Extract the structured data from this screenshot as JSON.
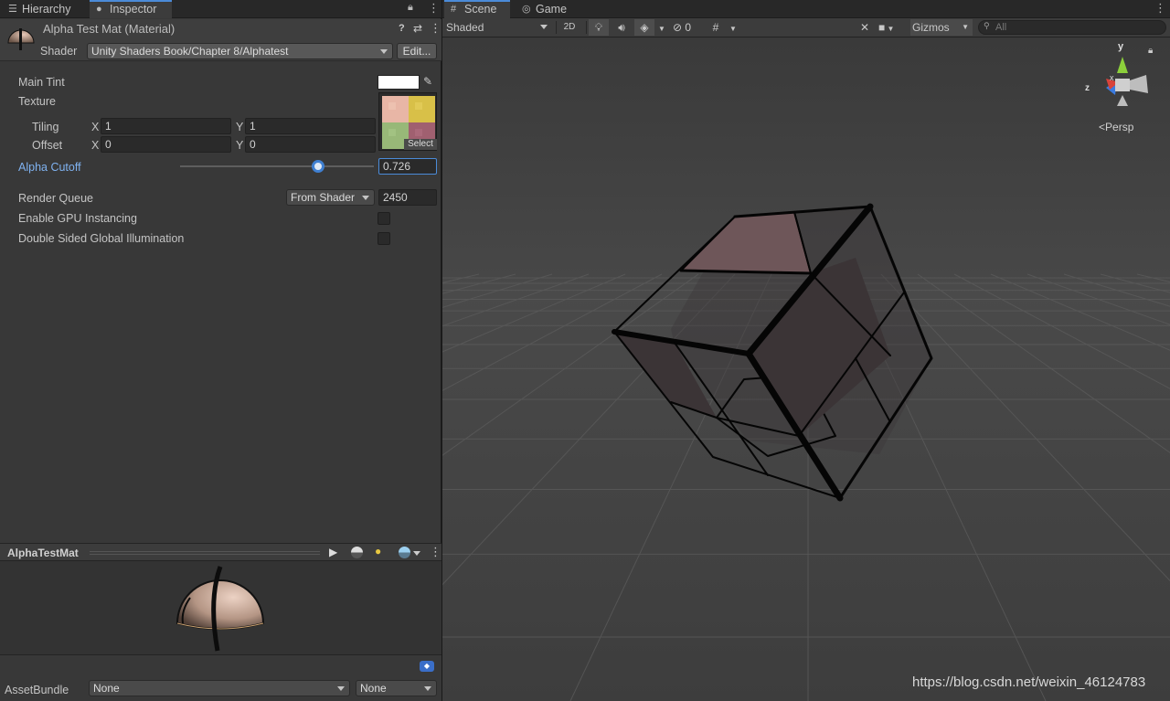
{
  "left_tabs": {
    "hierarchy": "Hierarchy",
    "inspector": "Inspector"
  },
  "material": {
    "title": "Alpha Test Mat (Material)",
    "shader_label": "Shader",
    "shader_value": "Unity Shaders Book/Chapter 8/Alphatest",
    "edit_button": "Edit...",
    "main_tint_label": "Main Tint",
    "main_tint_color": "#ffffff",
    "texture_label": "Texture",
    "texture_select": "Select",
    "tiling_label": "Tiling",
    "tiling_x": "1",
    "tiling_y": "1",
    "offset_label": "Offset",
    "offset_x": "0",
    "offset_y": "0",
    "x_label": "X",
    "y_label": "Y",
    "alpha_cutoff_label": "Alpha Cutoff",
    "alpha_cutoff_value": "0.726",
    "alpha_cutoff_fraction": 0.726,
    "render_queue_label": "Render Queue",
    "render_queue_mode": "From Shader",
    "render_queue_value": "2450",
    "gpu_instancing_label": "Enable GPU Instancing",
    "double_sided_gi_label": "Double Sided Global Illumination"
  },
  "preview": {
    "title": "AlphaTestMat"
  },
  "asset_bundle": {
    "label": "AssetBundle",
    "name": "None",
    "variant": "None"
  },
  "scene_tabs": {
    "scene": "Scene",
    "game": "Game"
  },
  "scene_toolbar": {
    "draw_mode": "Shaded",
    "mode_2d": "2D",
    "hidden_count": "0",
    "gizmos": "Gizmos",
    "search_placeholder": "All"
  },
  "gizmo": {
    "y": "y",
    "x": "x",
    "z": "z",
    "persp": "Persp"
  },
  "watermark": "https://blog.csdn.net/weixin_46124783",
  "colors": {
    "accent": "#4b8bd8",
    "alpha_label": "#7fb2f0",
    "gizmo_y": "#8ccf3b",
    "gizmo_x": "#d8433a",
    "gizmo_z": "#3a7be0",
    "cube_top": "#6e5659",
    "cube_face": "#3b3436"
  }
}
